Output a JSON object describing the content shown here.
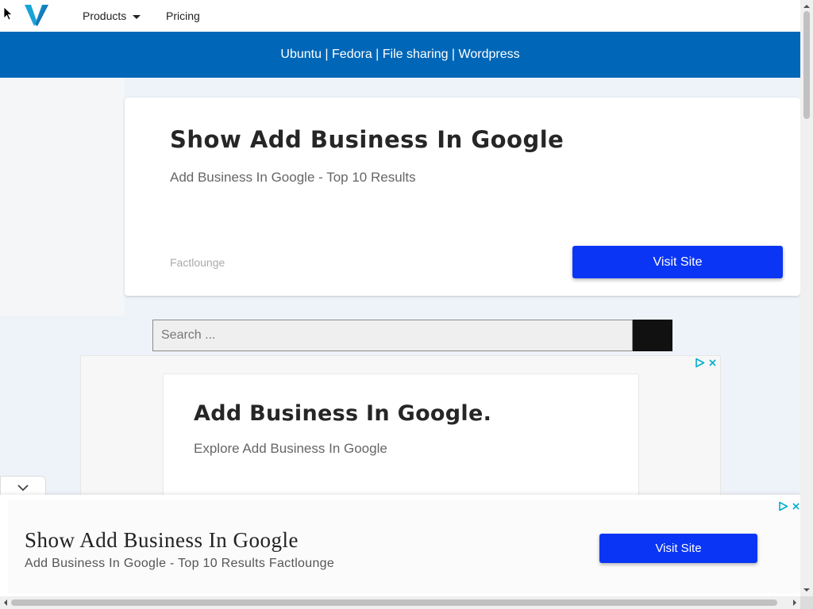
{
  "nav": {
    "products_label": "Products",
    "pricing_label": "Pricing"
  },
  "bluebar": {
    "links": [
      "Ubuntu",
      "Fedora",
      "File sharing",
      "Wordpress"
    ],
    "separator": " | "
  },
  "hero": {
    "title": "Show Add Business In Google",
    "subtitle": "Add Business In Google - Top 10 Results",
    "source": "Factlounge",
    "button_label": "Visit Site"
  },
  "search": {
    "placeholder": "Search ..."
  },
  "ad": {
    "title": "Add Business In Google.",
    "subtitle": "Explore Add Business In Google"
  },
  "bottom_ad": {
    "title": "Show Add Business In Google",
    "subtitle": "Add Business In Google - Top 10 Results Factlounge",
    "button_label": "Visit Site"
  },
  "colors": {
    "brand_blue": "#0067b8",
    "button_blue": "#0a35f5",
    "adchoices_cyan": "#00aecd"
  }
}
